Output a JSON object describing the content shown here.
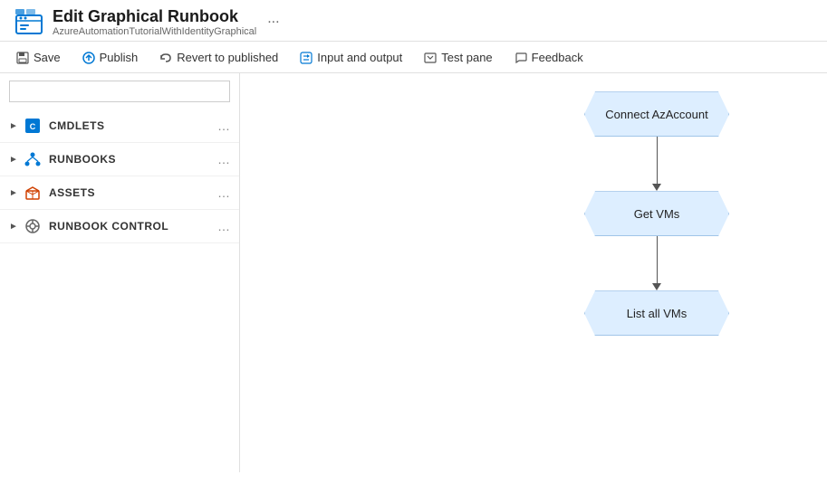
{
  "header": {
    "title": "Edit Graphical Runbook",
    "subtitle": "AzureAutomationTutorialWithIdentityGraphical",
    "ellipsis": "..."
  },
  "toolbar": {
    "save_label": "Save",
    "publish_label": "Publish",
    "revert_label": "Revert to published",
    "input_output_label": "Input and output",
    "test_pane_label": "Test pane",
    "feedback_label": "Feedback"
  },
  "sidebar": {
    "search_placeholder": "",
    "items": [
      {
        "id": "cmdlets",
        "label": "CMDLETS",
        "icon": "cmdlets-icon"
      },
      {
        "id": "runbooks",
        "label": "RUNBOOKS",
        "icon": "runbooks-icon"
      },
      {
        "id": "assets",
        "label": "ASSETS",
        "icon": "assets-icon"
      },
      {
        "id": "runbook-control",
        "label": "RUNBOOK CONTROL",
        "icon": "control-icon"
      }
    ]
  },
  "canvas": {
    "nodes": [
      {
        "id": "connect",
        "label": "Connect AzAccount"
      },
      {
        "id": "get-vms",
        "label": "Get VMs"
      },
      {
        "id": "list-vms",
        "label": "List all VMs"
      }
    ]
  }
}
